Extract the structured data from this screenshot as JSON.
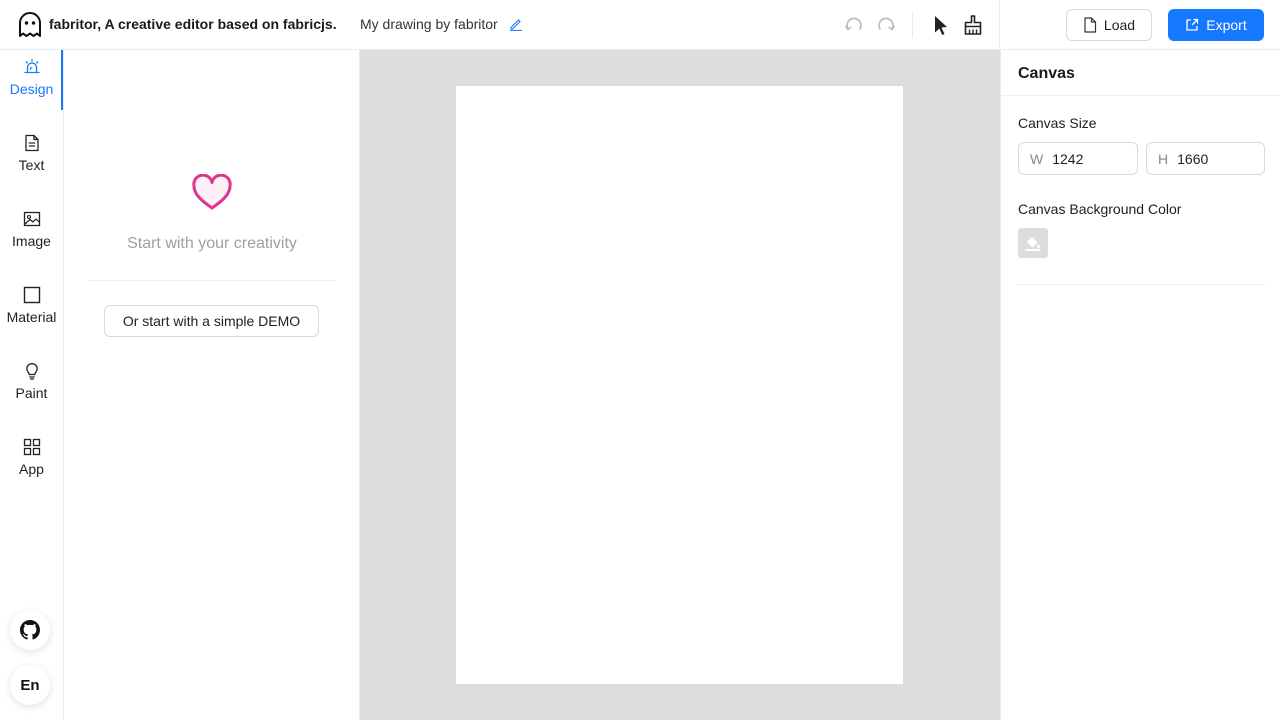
{
  "header": {
    "app_title": "fabritor, A creative editor based on fabricjs.",
    "doc_title": "My drawing by fabritor",
    "load_label": "Load",
    "export_label": "Export"
  },
  "nav": {
    "items": [
      {
        "label": "Design",
        "icon": "design-icon",
        "active": true
      },
      {
        "label": "Text",
        "icon": "text-icon",
        "active": false
      },
      {
        "label": "Image",
        "icon": "image-icon",
        "active": false
      },
      {
        "label": "Material",
        "icon": "square-icon",
        "active": false
      },
      {
        "label": "Paint",
        "icon": "bulb-icon",
        "active": false
      },
      {
        "label": "App",
        "icon": "app-grid-icon",
        "active": false
      }
    ],
    "language_label": "En"
  },
  "design_panel": {
    "tagline": "Start with your creativity",
    "demo_button_label": "Or start with a simple DEMO"
  },
  "properties": {
    "title": "Canvas",
    "size_label": "Canvas Size",
    "width_prefix": "W",
    "width_value": "1242",
    "height_prefix": "H",
    "height_value": "1660",
    "bg_label": "Canvas Background Color"
  },
  "colors": {
    "accent": "#1677ff",
    "heart": "#e0358f",
    "workspace_bg": "#dddddd",
    "canvas_bg": "#ffffff"
  }
}
